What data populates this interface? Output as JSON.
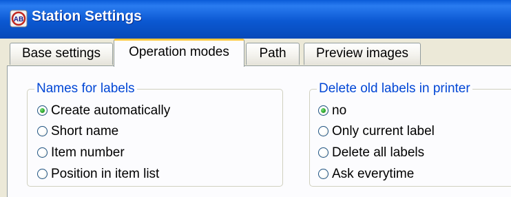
{
  "window": {
    "title": "Station Settings",
    "icon": "app-logo-icon"
  },
  "tabs": [
    {
      "label": "Base settings",
      "active": false
    },
    {
      "label": "Operation modes",
      "active": true
    },
    {
      "label": "Path",
      "active": false
    },
    {
      "label": "Preview images",
      "active": false
    }
  ],
  "groups": {
    "names_for_labels": {
      "legend": "Names for labels",
      "options": [
        {
          "label": "Create automatically",
          "checked": true
        },
        {
          "label": "Short name",
          "checked": false
        },
        {
          "label": "Item number",
          "checked": false
        },
        {
          "label": "Position in item list",
          "checked": false
        }
      ]
    },
    "delete_old_labels": {
      "legend": "Delete old labels in printer",
      "options": [
        {
          "label": "no",
          "checked": true
        },
        {
          "label": "Only current label",
          "checked": false
        },
        {
          "label": "Delete all labels",
          "checked": false
        },
        {
          "label": "Ask everytime",
          "checked": false
        }
      ]
    }
  },
  "colors": {
    "titlebar": "#0b58d2",
    "group_legend": "#0046d5",
    "active_tab_accent": "#ffc83c",
    "face": "#ece9d8"
  }
}
